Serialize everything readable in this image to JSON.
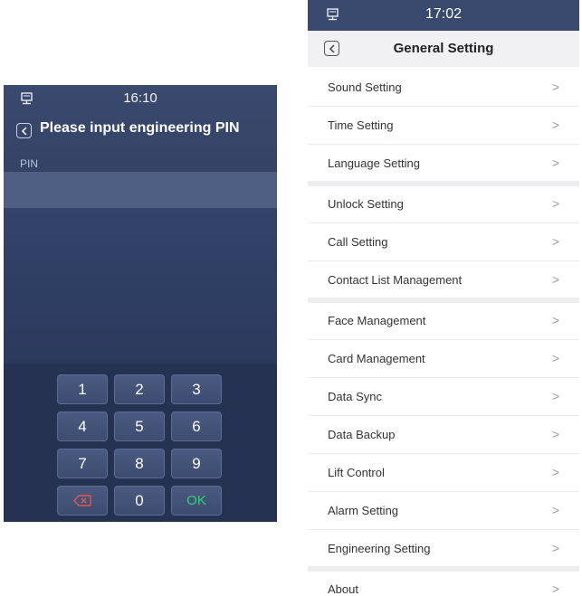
{
  "pin_screen": {
    "time": "16:10",
    "title": "Please input engineering PIN",
    "field_label": "PIN",
    "keys": [
      "1",
      "2",
      "3",
      "4",
      "5",
      "6",
      "7",
      "8",
      "9",
      "",
      "0",
      "OK"
    ],
    "colors": {
      "ok": "#2fd27a",
      "delete": "#e0554f"
    }
  },
  "settings_screen": {
    "time": "17:02",
    "title": "General Setting",
    "items": [
      {
        "label": "Sound Setting"
      },
      {
        "label": "Time Setting"
      },
      {
        "label": "Language Setting"
      },
      {
        "label": "Unlock Setting"
      },
      {
        "label": "Call Setting"
      },
      {
        "label": "Contact List Management"
      },
      {
        "label": "Face Management"
      },
      {
        "label": "Card Management"
      },
      {
        "label": "Data Sync"
      },
      {
        "label": "Data Backup"
      },
      {
        "label": "Lift Control"
      },
      {
        "label": "Alarm Setting"
      },
      {
        "label": "Engineering Setting"
      },
      {
        "label": "About"
      }
    ],
    "chevron": ">"
  }
}
